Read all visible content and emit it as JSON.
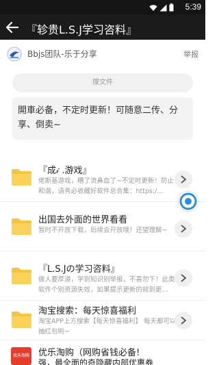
{
  "status_bar": {
    "time": "5:39"
  },
  "app_bar": {
    "title": "『轸贵L.S.J学习咨料』"
  },
  "group": {
    "name": "Bbjs团队-乐于分享",
    "report_label": "举报"
  },
  "search": {
    "placeholder": "搜文件"
  },
  "notice": {
    "text": "開車必备，不定时更新！可随意二传、分享、倒卖~"
  },
  "items": [
    {
      "title": "『成𝒾 .游戏』",
      "desc": "佬斯基游戏，糟了流鼻血了~不定时更新！防止和谐，请务必收藏好软件总合集：https:/..."
    },
    {
      "title": "出国去外面的世界看看",
      "desc": "暂时不开放下载，后续会开放哦！还望理解~"
    },
    {
      "title": "『L.S.Jの学习咨料』",
      "desc": "做人要厚道，学到知识别举报，不喜勿下！此类软件个别资源失效，如果提示更新的就到更..."
    },
    {
      "title": "淘宝搜索：每天惊喜福利",
      "desc": "淘宝APP上方搜索【每天惊喜福利】 每天都可以抽红包哟~"
    }
  ],
  "promo": {
    "thumb_label": "优乐淘购",
    "title": "优乐淘购（网购省钱必备!",
    "subtitle": "强，最全面的奇隐藏内部优惠券"
  },
  "colors": {
    "appbar": "#1b1b1b",
    "folder": "#f7c23c",
    "float_ring": "#2a8fd8"
  }
}
